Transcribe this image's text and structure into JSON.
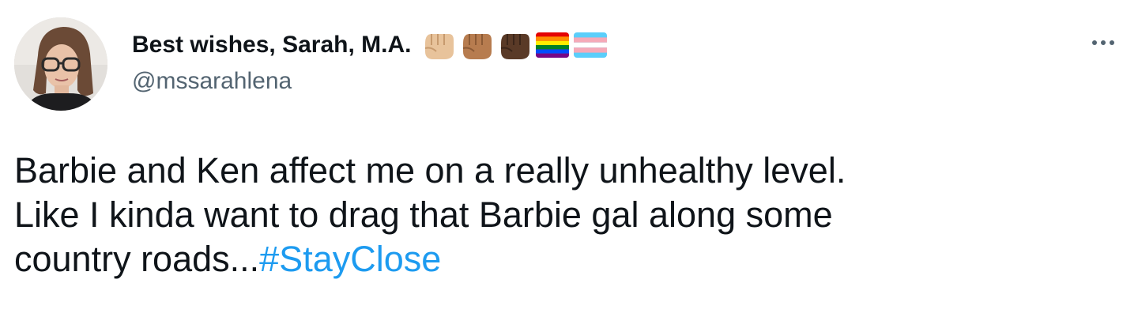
{
  "author": {
    "display_name": "Best wishes, Sarah, M.A.",
    "handle": "@mssarahlena",
    "name_emojis": [
      "raised-fist-light-skin-icon",
      "raised-fist-medium-skin-icon",
      "raised-fist-dark-skin-icon",
      "rainbow-flag-icon",
      "transgender-flag-icon"
    ]
  },
  "tweet": {
    "line1": "Barbie and Ken affect me on a really unhealthy level.",
    "line2": "Like I kinda want to drag that Barbie gal along some",
    "line3_text": "country roads...",
    "hashtag": "#StayClose"
  },
  "actions": {
    "more_icon": "more-horizontal-icon"
  },
  "colors": {
    "text": "#0f1419",
    "secondary": "#536471",
    "link": "#1d9bf0",
    "background": "#ffffff"
  }
}
